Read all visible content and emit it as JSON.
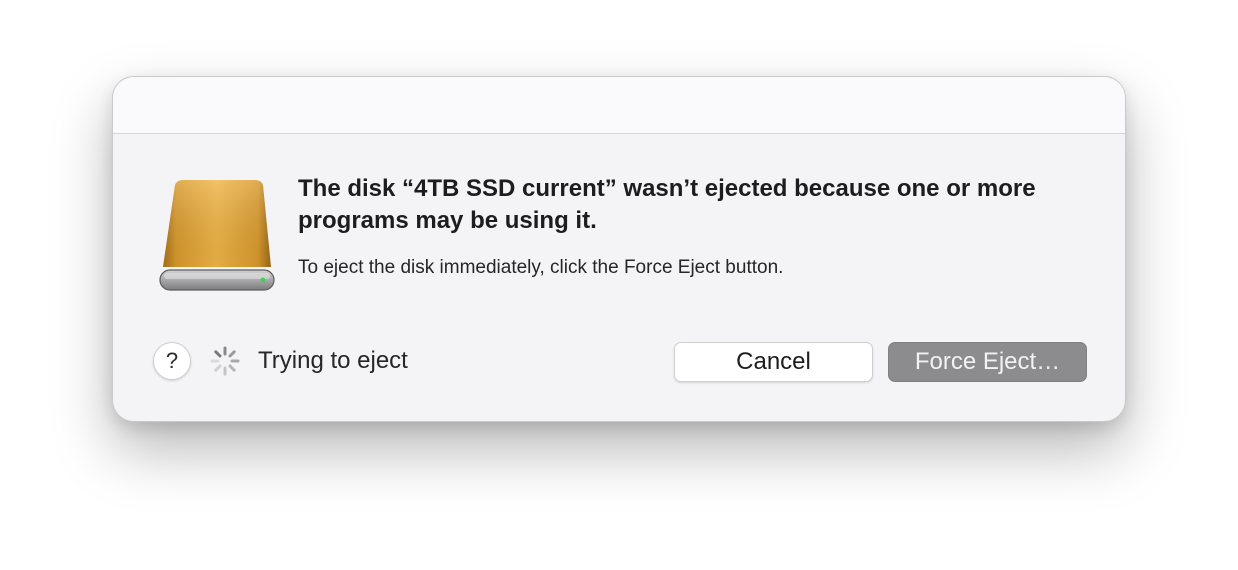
{
  "dialog": {
    "headline": "The disk “4TB SSD current” wasn’t ejected because one or more programs may be using it.",
    "message": "To eject the disk immediately, click the Force Eject button.",
    "help_label": "?",
    "status_text": "Trying to eject",
    "cancel_label": "Cancel",
    "force_eject_label": "Force Eject…",
    "icons": {
      "disk": "external-drive-icon",
      "spinner": "progress-spinner-icon"
    },
    "colors": {
      "disk_gold": "#e6a62f",
      "force_eject_bg": "#8c8b8e",
      "dialog_bg": "#f4f3f5"
    }
  }
}
